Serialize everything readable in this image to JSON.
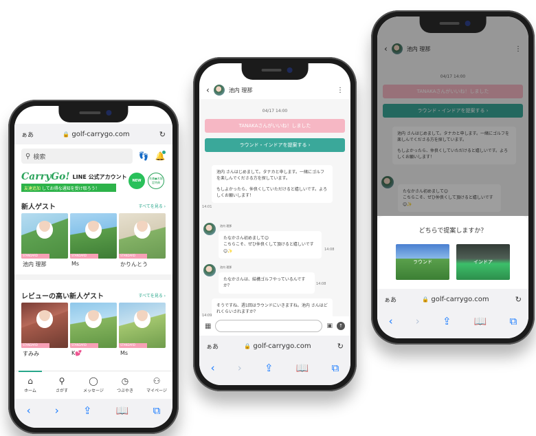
{
  "browser": {
    "aa_label": "ぁあ",
    "url": "golf-carrygo.com",
    "reload": "↻",
    "nav": {
      "back": "‹",
      "forward": "›",
      "share": "⇪",
      "bookmarks": "📖",
      "tabs": "⧉"
    }
  },
  "home": {
    "search_placeholder": "検索",
    "banner": {
      "logo": "CarryGo!",
      "title": "LINE 公式アカウント",
      "strip_highlight": "友達追加",
      "strip_text": "してお得な通知を受け取ろう！",
      "badge_new": "NEW",
      "badge_ex": "先着●名限定特典"
    },
    "section_new": {
      "title": "新人ゲスト",
      "more": "すべてを見る ›"
    },
    "guests_new": [
      {
        "name": "池内 理那",
        "tag": "STANDARD"
      },
      {
        "name": "Ms",
        "tag": "STANDARD"
      },
      {
        "name": "かりんとう",
        "tag": "STANDARD"
      }
    ],
    "section_review": {
      "title": "レビューの高い新人ゲスト",
      "more": "すべてを見る ›"
    },
    "guests_review": [
      {
        "name": "すみみ",
        "tag": "STANDARD"
      },
      {
        "name": "K💕",
        "tag": "STANDARD"
      },
      {
        "name": "Ms",
        "tag": "STANDARD"
      }
    ],
    "tabs": [
      {
        "label": "ホーム",
        "icon": "home-icon",
        "glyph": "⌂"
      },
      {
        "label": "さがす",
        "icon": "search-people-icon",
        "glyph": "⚲"
      },
      {
        "label": "メッセージ",
        "icon": "message-icon",
        "glyph": "◯"
      },
      {
        "label": "つぶやき",
        "icon": "clock-icon",
        "glyph": "◷"
      },
      {
        "label": "マイページ",
        "icon": "person-icon",
        "glyph": "⚇"
      }
    ]
  },
  "chat": {
    "partner_name": "池内 理那",
    "date": "04/17 14:00",
    "like_pill": "TANAKAさんがいいね！しました",
    "propose_pill": "ラウンド・インドアを提案する ›",
    "messages": [
      {
        "text1": "池内 さんはじめまして。タナカと申します。一緒にゴルフを楽しんでくださる方を探しています。",
        "text2": "もしよかったら、仲良くしていただけると嬉しいです。よろしくお願いします！",
        "time": "14:01"
      },
      {
        "sender": "池内 理那",
        "text1": "たなかさん初めまして😊",
        "text2": "こちらこそ、ぜひ仲良くして頂けると嬉しいです😊✨",
        "time": "14:08"
      },
      {
        "sender": "池内 理那",
        "text1": "たなかさんは、結構ゴルフやっているんですか？",
        "time": "14:08"
      },
      {
        "text1": "そうですね、週1回はラウンドにいきますね。池内 さんはどれくらいされますか？",
        "time": "14:09"
      }
    ]
  },
  "proposal": {
    "sheet_title": "どちらで提案しますか？",
    "option_round": "ラウンド",
    "option_indoor": "インドア"
  }
}
